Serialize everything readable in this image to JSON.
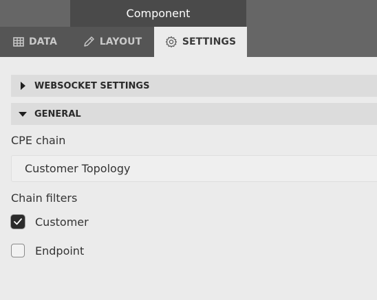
{
  "header": {
    "title": "Component"
  },
  "tabs": [
    {
      "label": "DATA",
      "icon": "table-icon"
    },
    {
      "label": "LAYOUT",
      "icon": "pencil-icon"
    },
    {
      "label": "SETTINGS",
      "icon": "gear-icon"
    }
  ],
  "sections": {
    "websocket": {
      "label": "WEBSOCKET SETTINGS",
      "expanded": false
    },
    "general": {
      "label": "GENERAL",
      "expanded": true
    }
  },
  "form": {
    "cpe_chain_label": "CPE chain",
    "cpe_chain_value": "Customer Topology",
    "chain_filters_label": "Chain filters",
    "filters": [
      {
        "label": "Customer",
        "checked": true
      },
      {
        "label": "Endpoint",
        "checked": false
      }
    ]
  },
  "colors": {
    "topbar": "#666666",
    "header": "#4a4a4a",
    "active_tab": "#ebebeb",
    "section_bg": "#dcdcdc",
    "checkbox_checked": "#2b2b2b"
  }
}
